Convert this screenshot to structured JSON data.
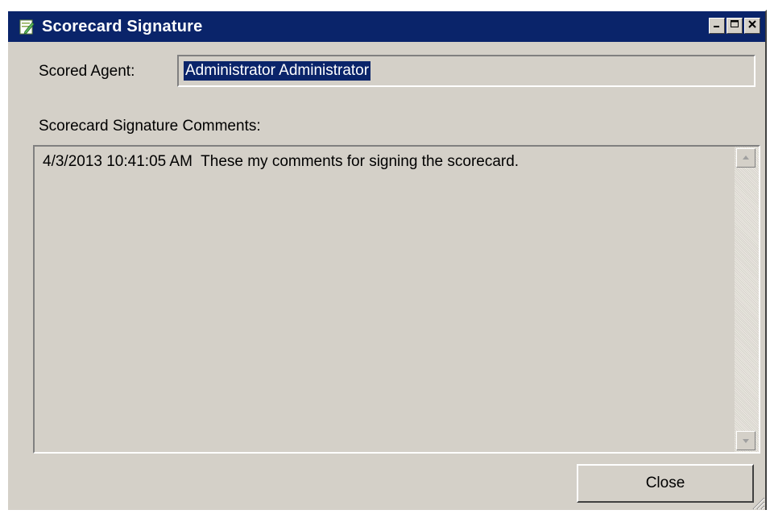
{
  "window": {
    "title": "Scorecard Signature",
    "icon": "document-edit-icon",
    "controls": {
      "minimize": "minimize-icon",
      "maximize": "maximize-icon",
      "close": "close-icon"
    }
  },
  "form": {
    "scored_agent_label": "Scored Agent:",
    "scored_agent_value": "Administrator Administrator",
    "comments_label": "Scorecard Signature Comments:",
    "comments_text": "4/3/2013 10:41:05 AM  These my comments for signing the scorecard."
  },
  "buttons": {
    "close_label": "Close"
  },
  "colors": {
    "titlebar": "#0a246a",
    "window_face": "#d4d0c8",
    "selection": "#0a246a"
  }
}
